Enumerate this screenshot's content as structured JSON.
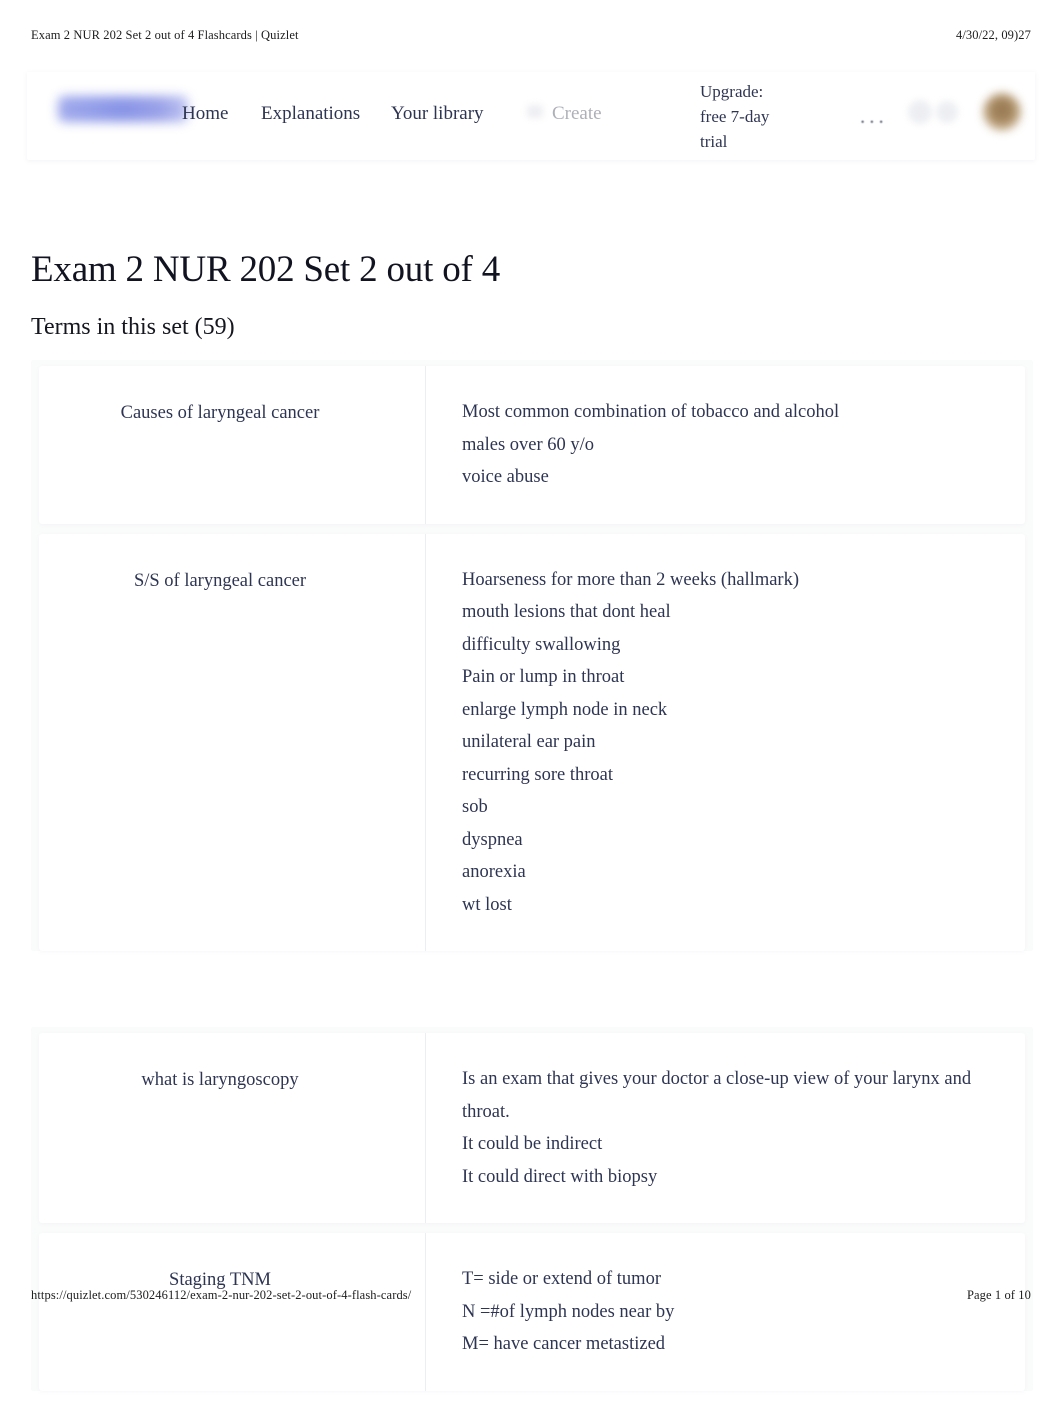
{
  "print": {
    "header_title": "Exam 2 NUR 202 Set 2 out of 4 Flashcards | Quizlet",
    "header_date": "4/30/22, 09)27",
    "footer_url": "https://quizlet.com/530246112/exam-2-nur-202-set-2-out-of-4-flash-cards/",
    "footer_page": "Page 1 of 10"
  },
  "nav": {
    "logo_alt": "Quizlet",
    "home": "Home",
    "explanations": "Explanations",
    "your_library": "Your library",
    "create": "Create",
    "upgrade": "Upgrade: free 7-day trial",
    "more": "...",
    "accent_color": "#8d99e8"
  },
  "page": {
    "title": "Exam 2 NUR 202 Set 2 out of 4",
    "terms_heading": "Terms in this set (59)"
  },
  "cards": [
    {
      "term": "Causes of laryngeal cancer",
      "definition": [
        "Most common combination of tobacco and alcohol",
        "males over 60 y/o",
        "voice abuse"
      ]
    },
    {
      "term": "S/S of laryngeal cancer",
      "definition": [
        "Hoarseness for more than 2 weeks (hallmark)",
        "mouth lesions that dont heal",
        "difficulty swallowing",
        "Pain or lump in throat",
        "enlarge lymph node in neck",
        "unilateral ear pain",
        "recurring sore throat",
        "sob",
        "dyspnea",
        "anorexia",
        "wt lost"
      ]
    },
    {
      "term": "what is laryngoscopy",
      "definition": [
        "Is an exam that gives your doctor a close-up view of your larynx and throat.",
        "It could be indirect",
        "It could direct with biopsy"
      ]
    },
    {
      "term": "Staging TNM",
      "definition": [
        "T= side or extend of tumor",
        "N =#of lymph nodes near by",
        "M= have cancer metastized"
      ]
    }
  ]
}
